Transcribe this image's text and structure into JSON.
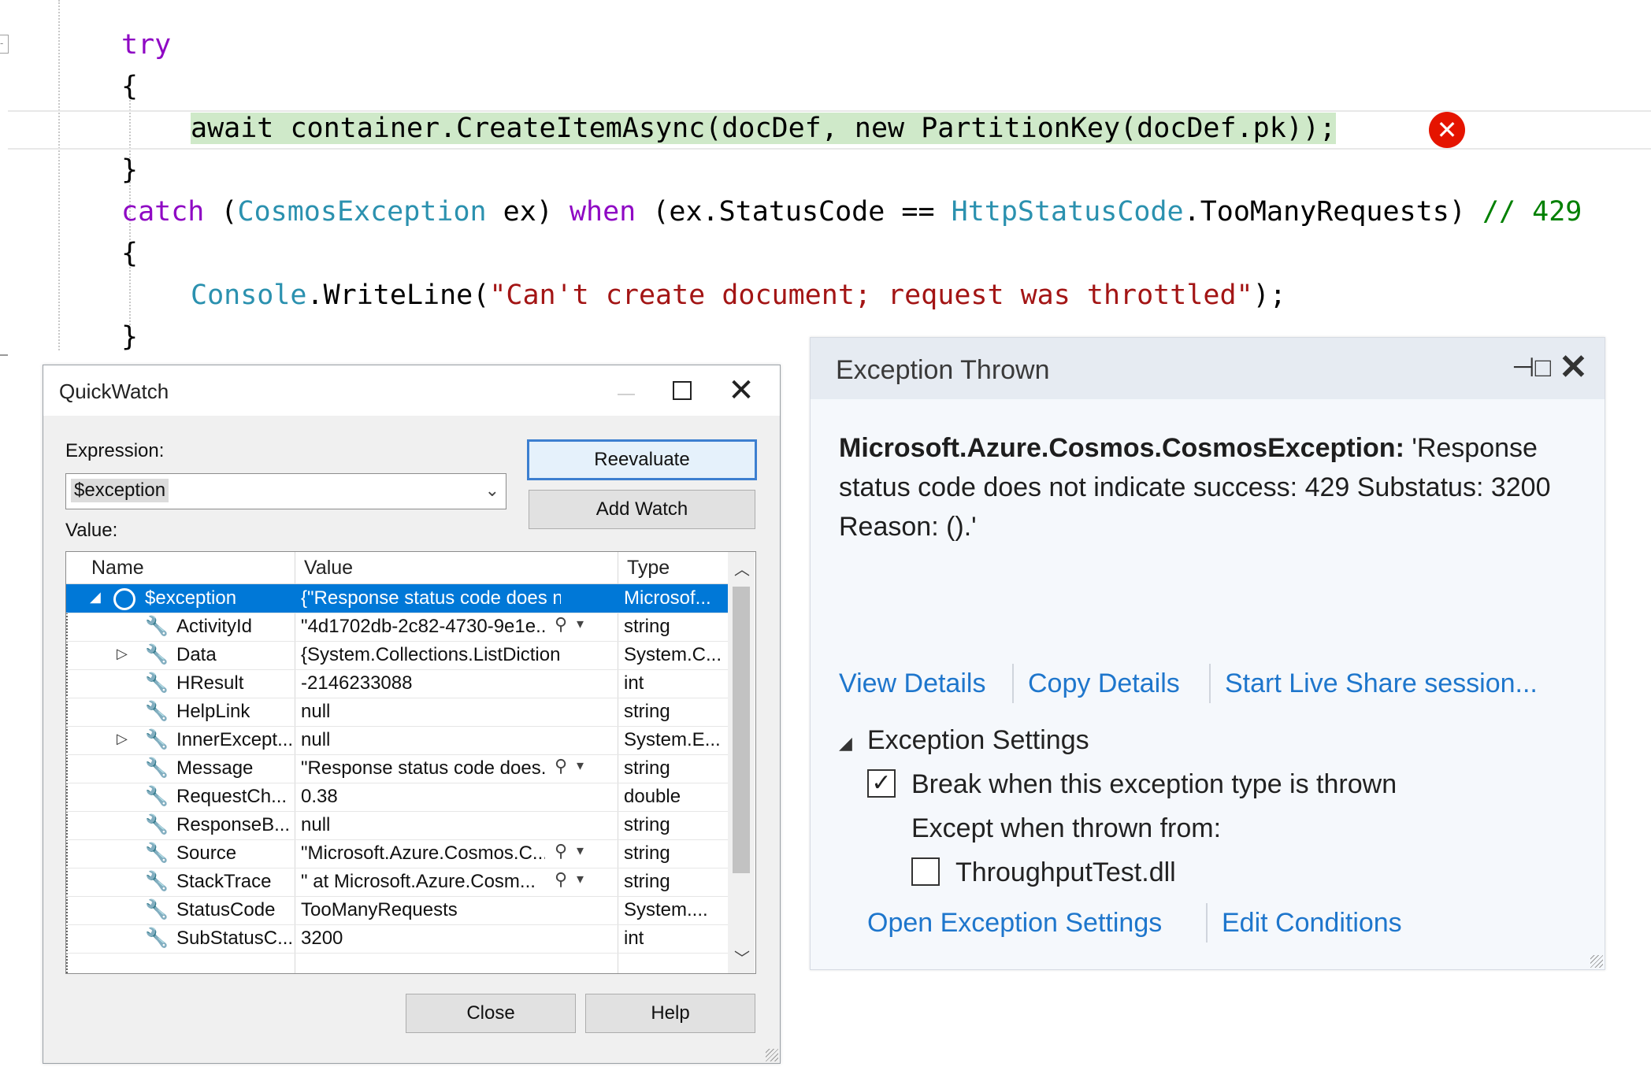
{
  "editor": {
    "lines": {
      "l1": "try",
      "l2": "{",
      "l3_kw": "await ",
      "l3_rest": "container.CreateItemAsync(docDef, ",
      "l3_new": "new ",
      "l3_tail": "PartitionKey(docDef.pk));",
      "l4": "}",
      "l5_catch": "catch",
      "l5_open": " (",
      "l5_type": "CosmosException",
      "l5_ex": " ex) ",
      "l5_when": "when",
      "l5_cond": " (ex.StatusCode == ",
      "l5_http": "HttpStatusCode",
      "l5_tmr": ".TooManyRequests) ",
      "l5_comment": "// 429",
      "l6": "{",
      "l7_console": "Console",
      "l7_write": ".WriteLine(",
      "l7_str": "\"Can't create document; request was throttled\"",
      "l7_end": ");",
      "l8": "}"
    },
    "error_icon": "error-x-icon"
  },
  "quickwatch": {
    "title": "QuickWatch",
    "expression_label": "Expression:",
    "expression_value": "$exception",
    "value_label": "Value:",
    "reevaluate": "Reevaluate",
    "add_watch": "Add Watch",
    "close": "Close",
    "help": "Help",
    "columns": [
      "Name",
      "Value",
      "Type"
    ],
    "rows": [
      {
        "name": "$exception",
        "value": "{\"Response status code does not ...",
        "type": "Microsof..."
      },
      {
        "name": "ActivityId",
        "value": "\"4d1702db-2c82-4730-9e1e...",
        "type": "string"
      },
      {
        "name": "Data",
        "value": "{System.Collections.ListDictionar...",
        "type": "System.C..."
      },
      {
        "name": "HResult",
        "value": "-2146233088",
        "type": "int"
      },
      {
        "name": "HelpLink",
        "value": "null",
        "type": "string"
      },
      {
        "name": "InnerExcept...",
        "value": "null",
        "type": "System.E..."
      },
      {
        "name": "Message",
        "value": "\"Response status code does...",
        "type": "string"
      },
      {
        "name": "RequestCh...",
        "value": "0.38",
        "type": "double"
      },
      {
        "name": "ResponseB...",
        "value": "null",
        "type": "string"
      },
      {
        "name": "Source",
        "value": "\"Microsoft.Azure.Cosmos.C...",
        "type": "string"
      },
      {
        "name": "StackTrace",
        "value": "\"   at Microsoft.Azure.Cosm...",
        "type": "string"
      },
      {
        "name": "StatusCode",
        "value": "TooManyRequests",
        "type": "System...."
      },
      {
        "name": "SubStatusC...",
        "value": "3200",
        "type": "int"
      }
    ]
  },
  "exception_popup": {
    "title": "Exception Thrown",
    "exception_type": "Microsoft.Azure.Cosmos.CosmosException:",
    "message": " 'Response status code does not indicate success: 429 Substatus: 3200 Reason: ().'",
    "view_details": "View Details",
    "copy_details": "Copy Details",
    "live_share": "Start Live Share session...",
    "settings_header": "Exception Settings",
    "break_when": "Break when this exception type is thrown",
    "except_when": "Except when thrown from:",
    "dll": "ThroughputTest.dll",
    "open_settings": "Open Exception Settings",
    "edit_conditions": "Edit Conditions",
    "break_checked": true,
    "dll_checked": false
  }
}
